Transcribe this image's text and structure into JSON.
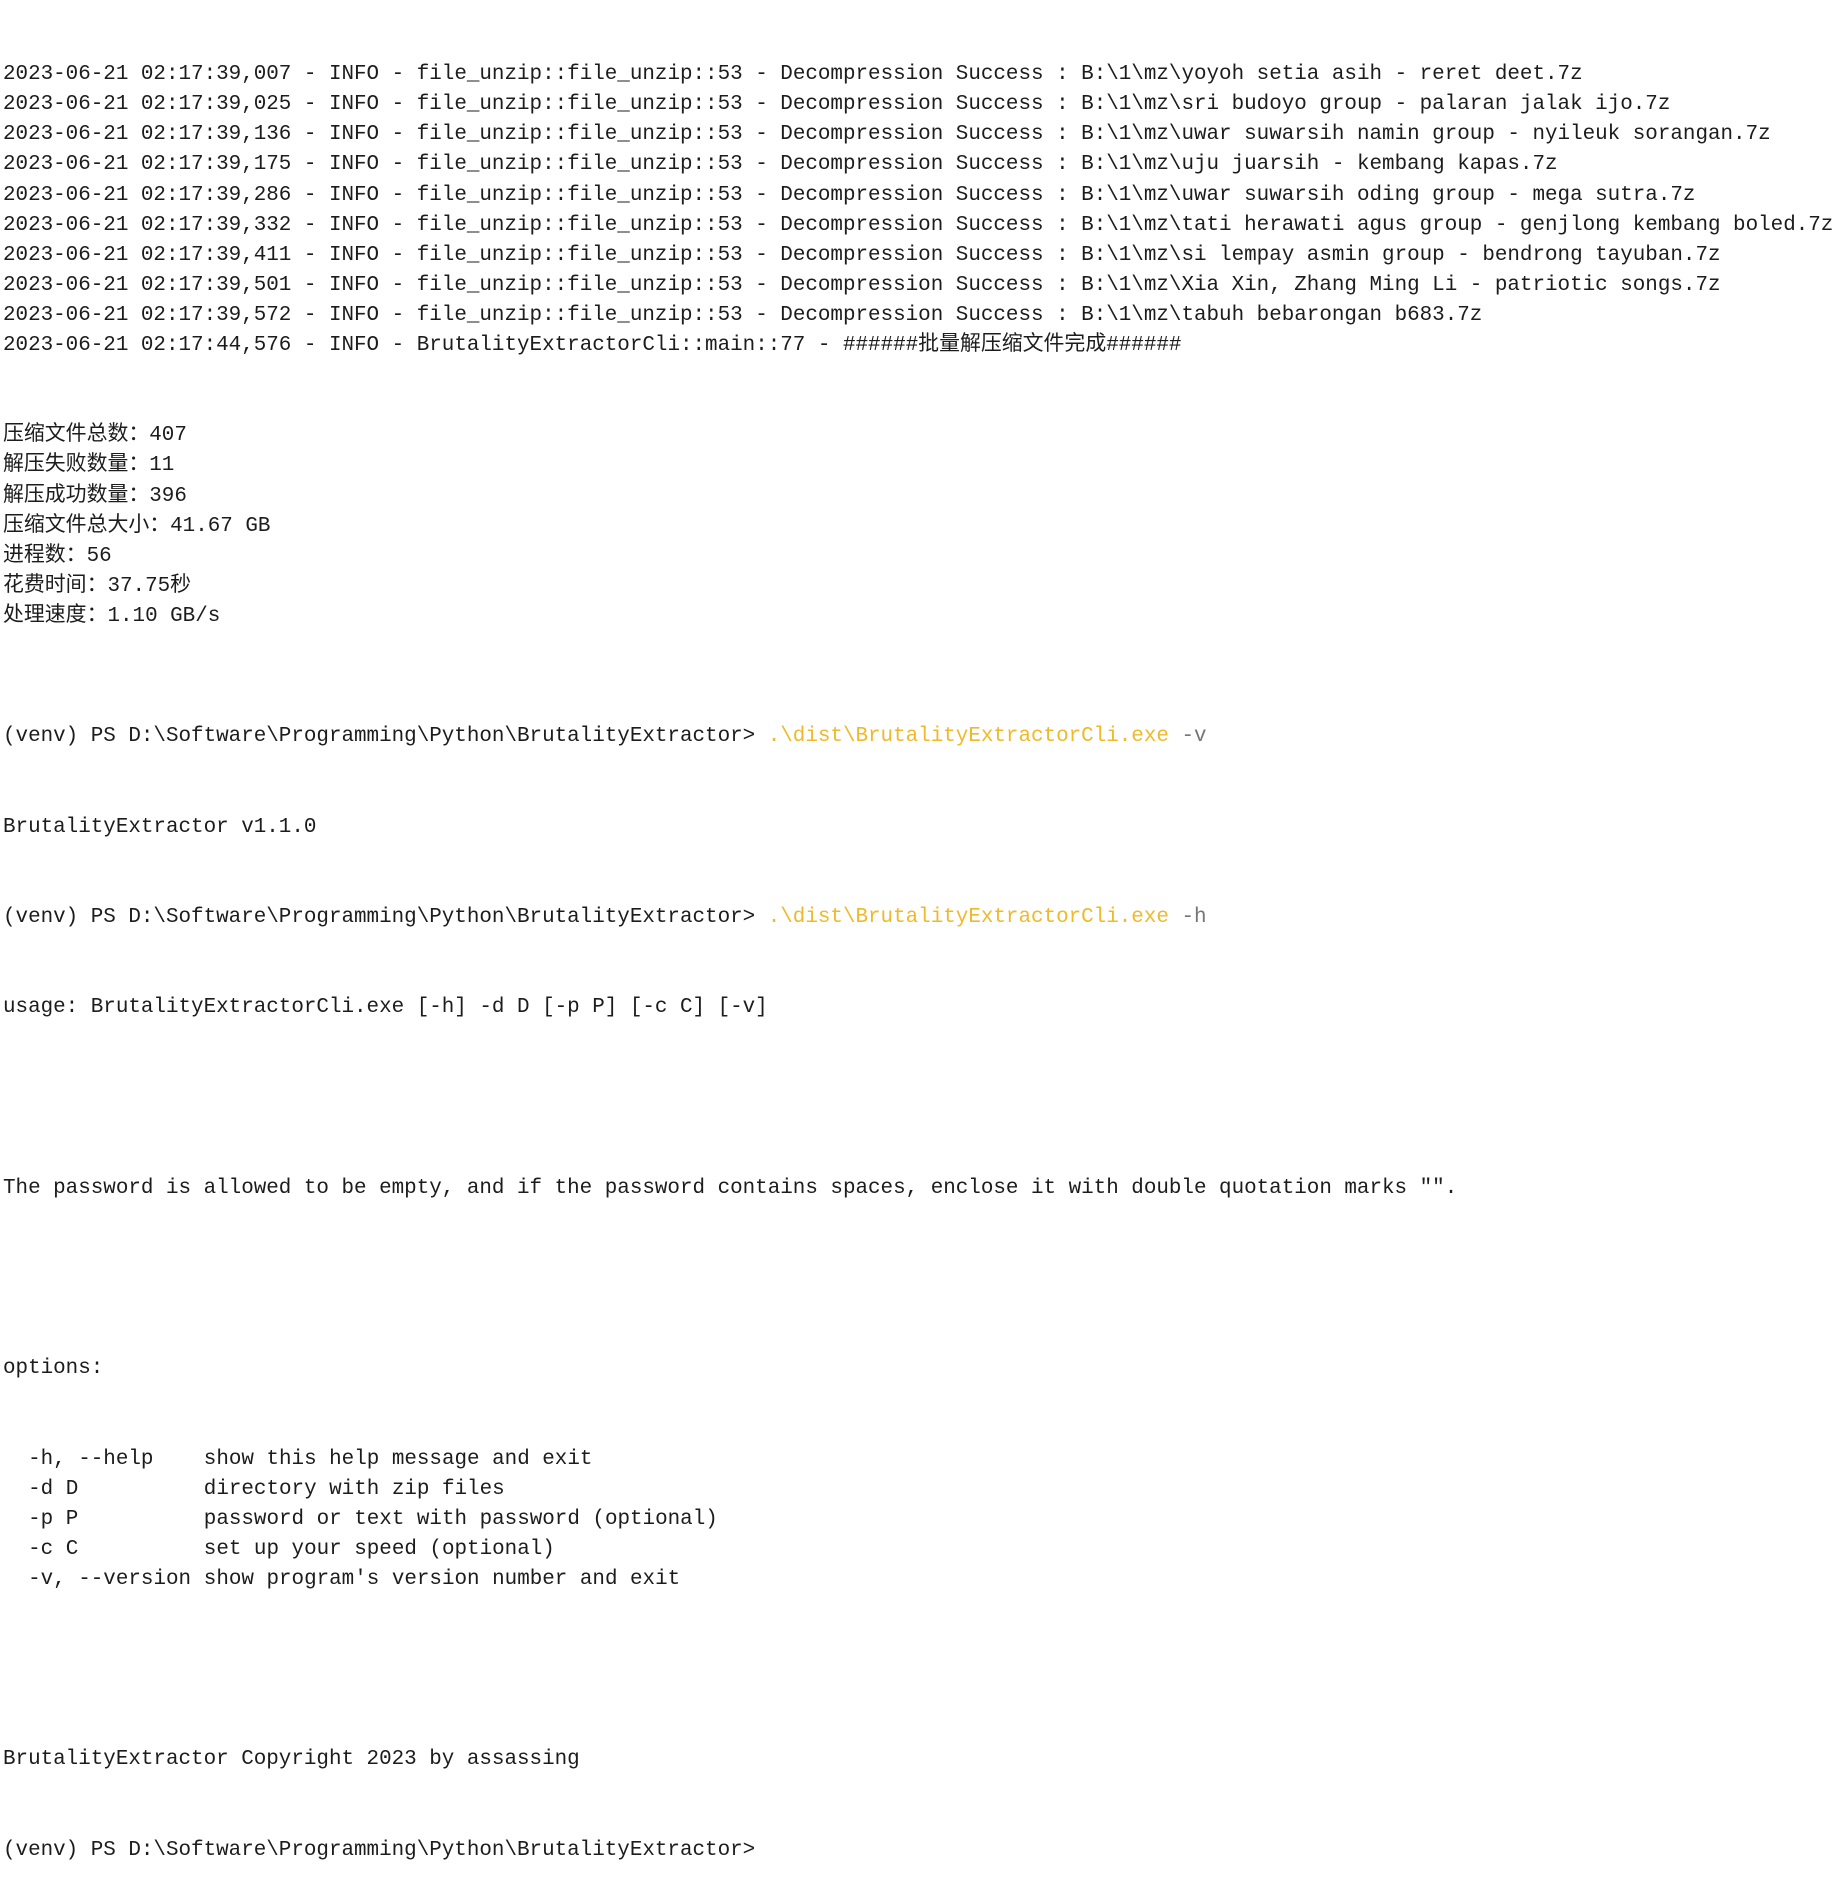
{
  "terminal": {
    "log_lines": [
      {
        "timestamp": "2023-06-21 02:17:39,007",
        "level": "INFO",
        "source": "file_unzip::file_unzip::53",
        "message": "Decompression Success : B:\\1\\mz\\yoyoh setia asih - reret deet.7z"
      },
      {
        "timestamp": "2023-06-21 02:17:39,025",
        "level": "INFO",
        "source": "file_unzip::file_unzip::53",
        "message": "Decompression Success : B:\\1\\mz\\sri budoyo group - palaran jalak ijo.7z"
      },
      {
        "timestamp": "2023-06-21 02:17:39,136",
        "level": "INFO",
        "source": "file_unzip::file_unzip::53",
        "message": "Decompression Success : B:\\1\\mz\\uwar suwarsih namin group - nyileuk sorangan.7z"
      },
      {
        "timestamp": "2023-06-21 02:17:39,175",
        "level": "INFO",
        "source": "file_unzip::file_unzip::53",
        "message": "Decompression Success : B:\\1\\mz\\uju juarsih - kembang kapas.7z"
      },
      {
        "timestamp": "2023-06-21 02:17:39,286",
        "level": "INFO",
        "source": "file_unzip::file_unzip::53",
        "message": "Decompression Success : B:\\1\\mz\\uwar suwarsih oding group - mega sutra.7z"
      },
      {
        "timestamp": "2023-06-21 02:17:39,332",
        "level": "INFO",
        "source": "file_unzip::file_unzip::53",
        "message": "Decompression Success : B:\\1\\mz\\tati herawati agus group - genjlong kembang boled.7z"
      },
      {
        "timestamp": "2023-06-21 02:17:39,411",
        "level": "INFO",
        "source": "file_unzip::file_unzip::53",
        "message": "Decompression Success : B:\\1\\mz\\si lempay asmin group - bendrong tayuban.7z"
      },
      {
        "timestamp": "2023-06-21 02:17:39,501",
        "level": "INFO",
        "source": "file_unzip::file_unzip::53",
        "message": "Decompression Success : B:\\1\\mz\\Xia Xin, Zhang Ming Li - patriotic songs.7z"
      },
      {
        "timestamp": "2023-06-21 02:17:39,572",
        "level": "INFO",
        "source": "file_unzip::file_unzip::53",
        "message": "Decompression Success : B:\\1\\mz\\tabuh bebarongan b683.7z"
      },
      {
        "timestamp": "2023-06-21 02:17:44,576",
        "level": "INFO",
        "source": "BrutalityExtractorCli::main::77",
        "message": "######批量解压缩文件完成######"
      }
    ],
    "summary": [
      {
        "label": "压缩文件总数：",
        "value": "407"
      },
      {
        "label": "解压失败数量：",
        "value": "11"
      },
      {
        "label": "解压成功数量：",
        "value": "396"
      },
      {
        "label": "压缩文件总大小：",
        "value": "41.67 GB"
      },
      {
        "label": "进程数：",
        "value": "56"
      },
      {
        "label": "花费时间：",
        "value": "37.75秒"
      },
      {
        "label": "处理速度：",
        "value": "1.10 GB/s"
      }
    ],
    "prompt": "(venv) PS D:\\Software\\Programming\\Python\\BrutalityExtractor> ",
    "command_version": {
      "path": ".\\dist\\BrutalityExtractorCli.exe",
      "flag": "-v"
    },
    "version_output": "BrutalityExtractor v1.1.0",
    "command_help": {
      "path": ".\\dist\\BrutalityExtractorCli.exe",
      "flag": "-h"
    },
    "usage": "usage: BrutalityExtractorCli.exe [-h] -d D [-p P] [-c C] [-v]",
    "description": "The password is allowed to be empty, and if the password contains spaces, enclose it with double quotation marks \"\".",
    "options_header": "options:",
    "options": [
      {
        "flag": "-h, --help",
        "help": "show this help message and exit"
      },
      {
        "flag": "-d D",
        "help": "directory with zip files"
      },
      {
        "flag": "-p P",
        "help": "password or text with password (optional)"
      },
      {
        "flag": "-c C",
        "help": "set up your speed (optional)"
      },
      {
        "flag": "-v, --version",
        "help": "show program's version number and exit"
      }
    ],
    "copyright": "BrutalityExtractor Copyright 2023 by assassing",
    "final_prompt": "(venv) PS D:\\Software\\Programming\\Python\\BrutalityExtractor>"
  },
  "colors": {
    "text": "#1c1c1c",
    "command_path": "#f0b92a",
    "command_flag": "#767676",
    "background": "#ffffff"
  }
}
